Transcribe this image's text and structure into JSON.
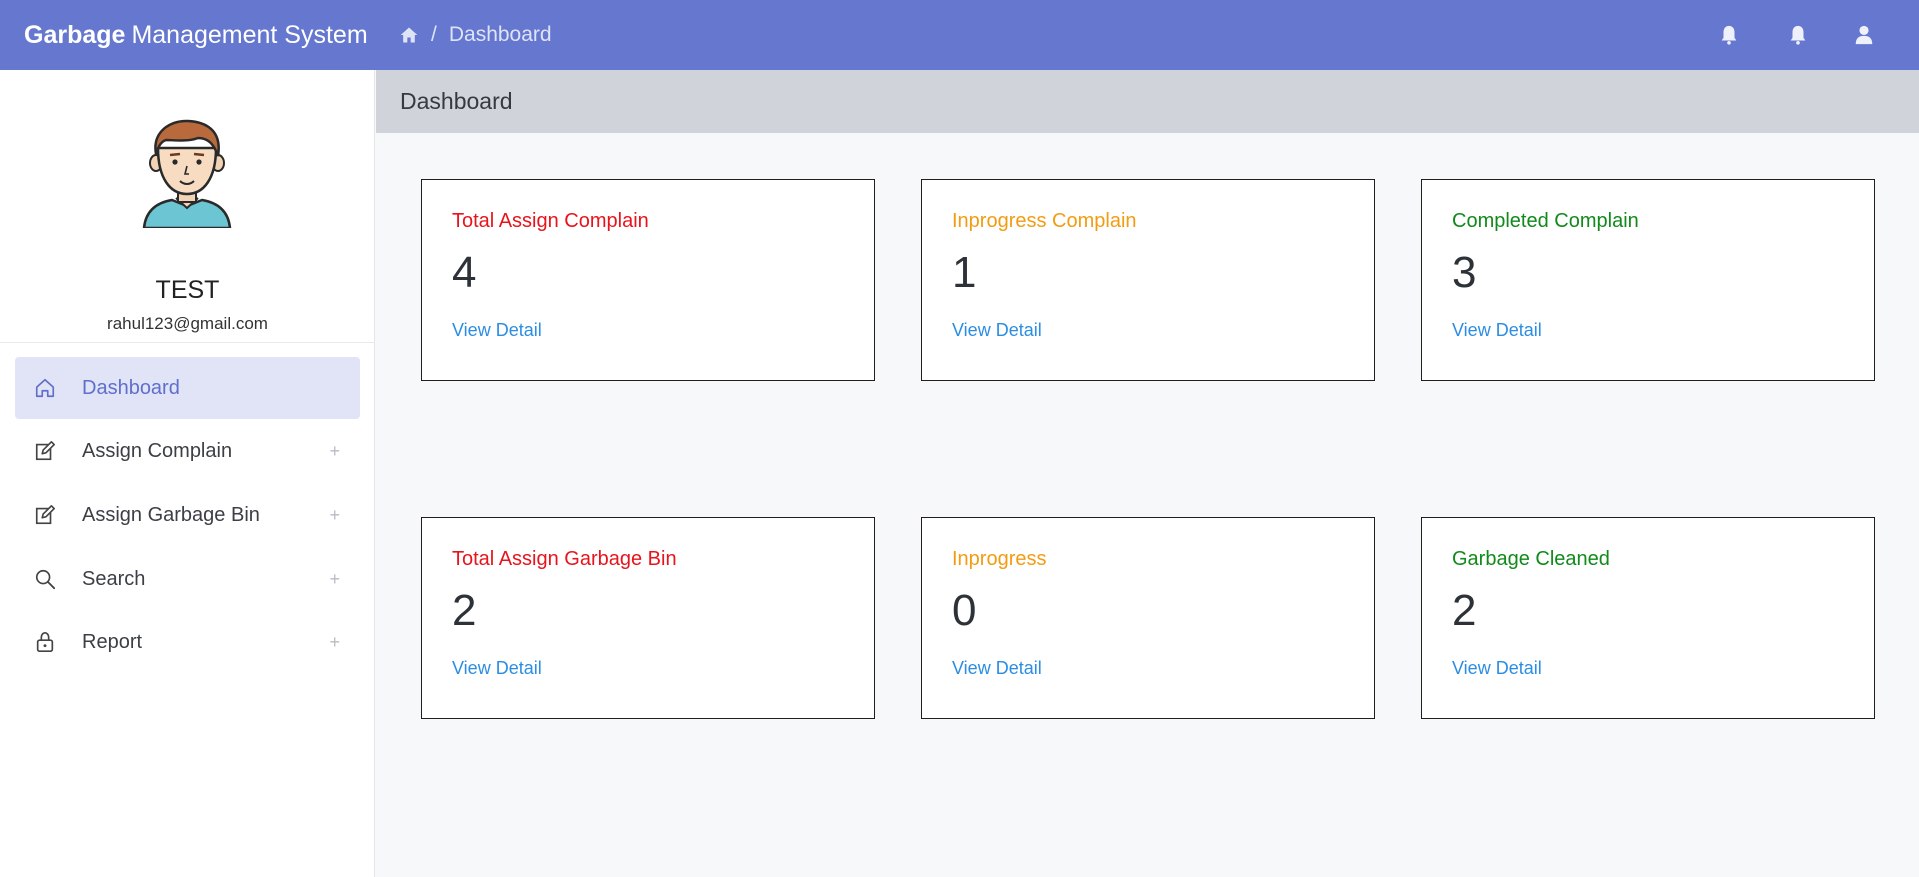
{
  "app": {
    "brand_bold": "Garbage",
    "brand_rest": "Management System"
  },
  "breadcrumb": {
    "home_icon": "home-icon",
    "separator": "/",
    "current": "Dashboard"
  },
  "topbar_icons": [
    "bell-icon",
    "bell-icon",
    "user-icon"
  ],
  "user": {
    "name": "TEST",
    "email": "rahul123@gmail.com"
  },
  "sidebar": {
    "items": [
      {
        "label": "Dashboard",
        "icon": "home-icon",
        "active": true,
        "expandable": false
      },
      {
        "label": "Assign Complain",
        "icon": "edit-icon",
        "active": false,
        "expandable": true,
        "expand_symbol": "+"
      },
      {
        "label": "Assign Garbage Bin",
        "icon": "edit-icon",
        "active": false,
        "expandable": true,
        "expand_symbol": "+"
      },
      {
        "label": "Search",
        "icon": "search-icon",
        "active": false,
        "expandable": true,
        "expand_symbol": "+"
      },
      {
        "label": "Report",
        "icon": "lock-icon",
        "active": false,
        "expandable": true,
        "expand_symbol": "+"
      }
    ]
  },
  "page": {
    "title": "Dashboard"
  },
  "cards": [
    {
      "title": "Total Assign Complain",
      "value": "4",
      "link": "View Detail",
      "color": "#e8141c"
    },
    {
      "title": "Inprogress Complain",
      "value": "1",
      "link": "View Detail",
      "color": "#f39c12"
    },
    {
      "title": "Completed Complain",
      "value": "3",
      "link": "View Detail",
      "color": "#118a1b"
    },
    {
      "title": "Total Assign Garbage Bin",
      "value": "2",
      "link": "View Detail",
      "color": "#e8141c"
    },
    {
      "title": "Inprogress",
      "value": "0",
      "link": "View Detail",
      "color": "#f39c12"
    },
    {
      "title": "Garbage Cleaned",
      "value": "2",
      "link": "View Detail",
      "color": "#118a1b"
    }
  ],
  "colors": {
    "topbar": "#6577cf",
    "active_menu_bg": "#e0e4f6",
    "active_menu_text": "#5f6fcb",
    "link": "#2b8de3"
  }
}
